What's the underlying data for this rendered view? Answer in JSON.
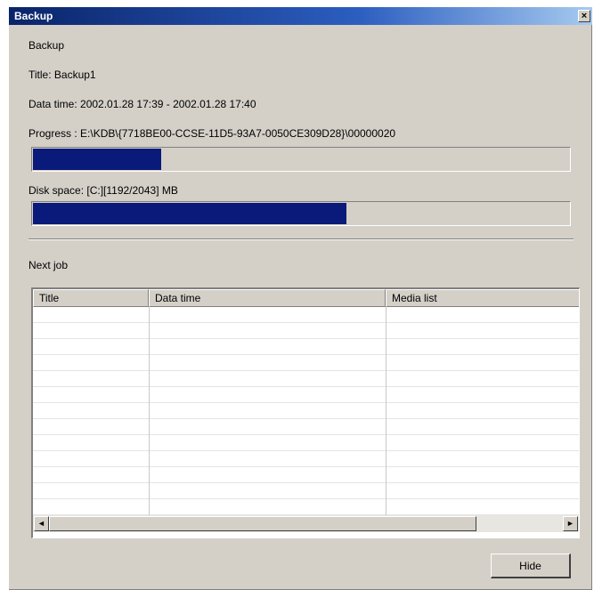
{
  "window": {
    "title": "Backup",
    "close_glyph": "×"
  },
  "info": {
    "heading": "Backup",
    "title_line": "Title: Backup1",
    "datetime_line": "Data time: 2002.01.28 17:39 - 2002.01.28 17:40",
    "progress_line": "Progress : E:\\KDB\\{7718BE00-CCSE-11D5-93A7-0050CE309D28}\\00000020",
    "disk_line": "Disk space: [C:][1192/2043] MB"
  },
  "progress": {
    "fraction": 0.24
  },
  "disk": {
    "fraction": 0.584
  },
  "next_job": {
    "label": "Next job",
    "columns": [
      "Title",
      "Data time",
      "Media list"
    ],
    "row_count": 13
  },
  "scrollbar": {
    "left_glyph": "◄",
    "right_glyph": "►"
  },
  "buttons": {
    "hide_label": "Hide"
  },
  "colors": {
    "bar_fill": "#0a1a7a",
    "titlebar": "#0a246a"
  }
}
